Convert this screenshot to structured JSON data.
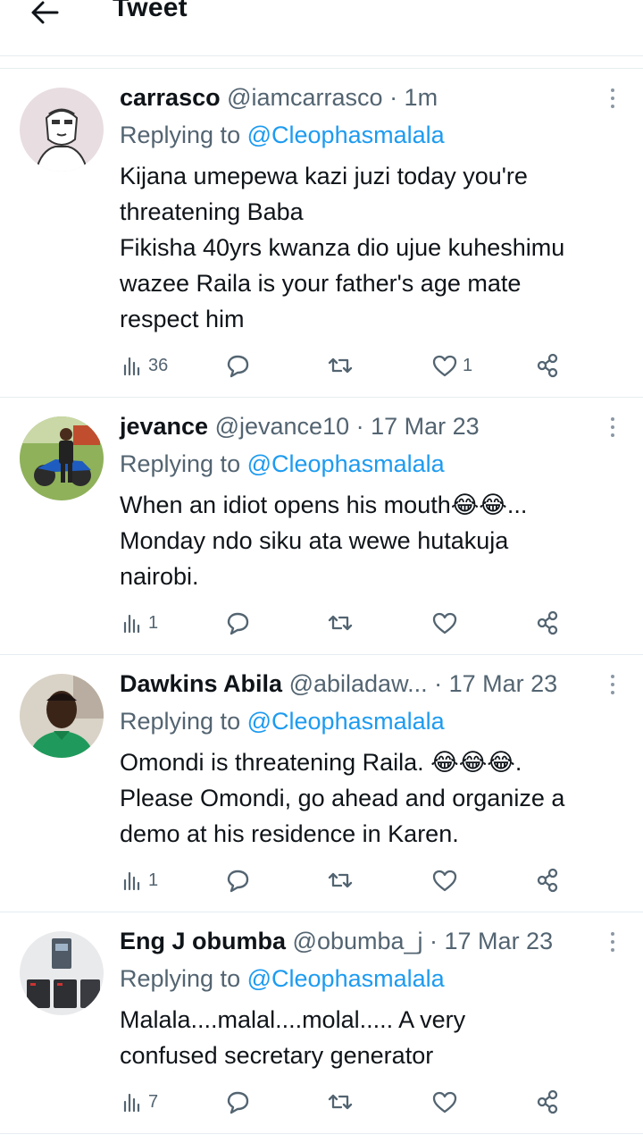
{
  "header": {
    "title": "Tweet"
  },
  "tweets": [
    {
      "name": "carrasco",
      "handle": "@iamcarrasco",
      "meta": " · 1m",
      "replying_prefix": "Replying to",
      "replying_to": "@Cleophasmalala",
      "text": "Kijana umepewa kazi juzi today you're\nthreatening Baba\nFikisha 40yrs kwanza dio ujue kuheshimu\nwazee Raila is your father's age mate\nrespect him",
      "views": "36",
      "replies": "",
      "retweets": "",
      "likes": "1"
    },
    {
      "name": "jevance",
      "handle": "@jevance10",
      "meta": " · 17 Mar 23",
      "replying_prefix": "Replying to",
      "replying_to": "@Cleophasmalala",
      "text": "When an idiot opens his mouth😂😂...\nMonday ndo siku ata wewe hutakuja\nnairobi.",
      "views": "1",
      "replies": "",
      "retweets": "",
      "likes": ""
    },
    {
      "name": "Dawkins Abila",
      "handle": "@abiladaw...",
      "meta": " · 17 Mar 23",
      "replying_prefix": "Replying to",
      "replying_to": "@Cleophasmalala",
      "text": "Omondi is threatening Raila. 😂😂😂.\nPlease Omondi, go ahead and organize a\ndemo at his residence in Karen.",
      "views": "1",
      "replies": "",
      "retweets": "",
      "likes": ""
    },
    {
      "name": "Eng J obumba",
      "handle": "@obumba_j",
      "meta": " · 17 Mar 23",
      "replying_prefix": "Replying to",
      "replying_to": "@Cleophasmalala",
      "text": "Malala....malal....molal..... A very\nconfused secretary generator",
      "views": "7",
      "replies": "",
      "retweets": "",
      "likes": ""
    }
  ],
  "icons": {
    "back": "arrow-left-icon",
    "more": "more-vertical-icon",
    "views": "bar-chart-icon",
    "reply": "speech-bubble-icon",
    "retweet": "retweet-icon",
    "like": "heart-icon",
    "share": "share-icon"
  },
  "colors": {
    "mention": "#1d9bf0",
    "secondary": "#536471",
    "text": "#0f1419"
  }
}
